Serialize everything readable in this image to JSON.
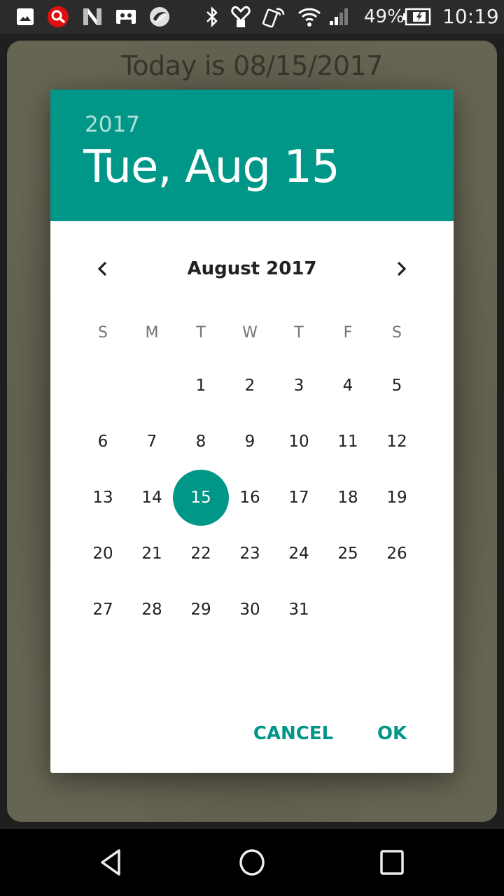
{
  "status_bar": {
    "notification_icons": [
      "gallery-icon",
      "search-app-icon",
      "n-app-icon",
      "voicemail-icon",
      "trend-micro-icon"
    ],
    "system_icons": [
      "bluetooth-icon",
      "heart-sync-icon",
      "nfc-phone-icon",
      "wifi-icon",
      "signal-icon",
      "battery-charging-icon"
    ],
    "battery_percent": "49%",
    "time": "10:19"
  },
  "app": {
    "today_text": "Today is 08/15/2017"
  },
  "dialog": {
    "accent_color": "#009688",
    "header": {
      "year": "2017",
      "date": "Tue, Aug 15"
    },
    "month_label": "August 2017",
    "prev_icon": "chevron-left-icon",
    "next_icon": "chevron-right-icon",
    "weekdays": [
      "S",
      "M",
      "T",
      "W",
      "T",
      "F",
      "S"
    ],
    "weeks": [
      [
        "",
        "",
        "1",
        "2",
        "3",
        "4",
        "5"
      ],
      [
        "6",
        "7",
        "8",
        "9",
        "10",
        "11",
        "12"
      ],
      [
        "13",
        "14",
        "15",
        "16",
        "17",
        "18",
        "19"
      ],
      [
        "20",
        "21",
        "22",
        "23",
        "24",
        "25",
        "26"
      ],
      [
        "27",
        "28",
        "29",
        "30",
        "31",
        "",
        ""
      ]
    ],
    "selected_day": "15",
    "cancel_label": "CANCEL",
    "ok_label": "OK"
  },
  "nav_bar": {
    "back_icon": "back-icon",
    "home_icon": "home-icon",
    "recents_icon": "recents-icon"
  }
}
